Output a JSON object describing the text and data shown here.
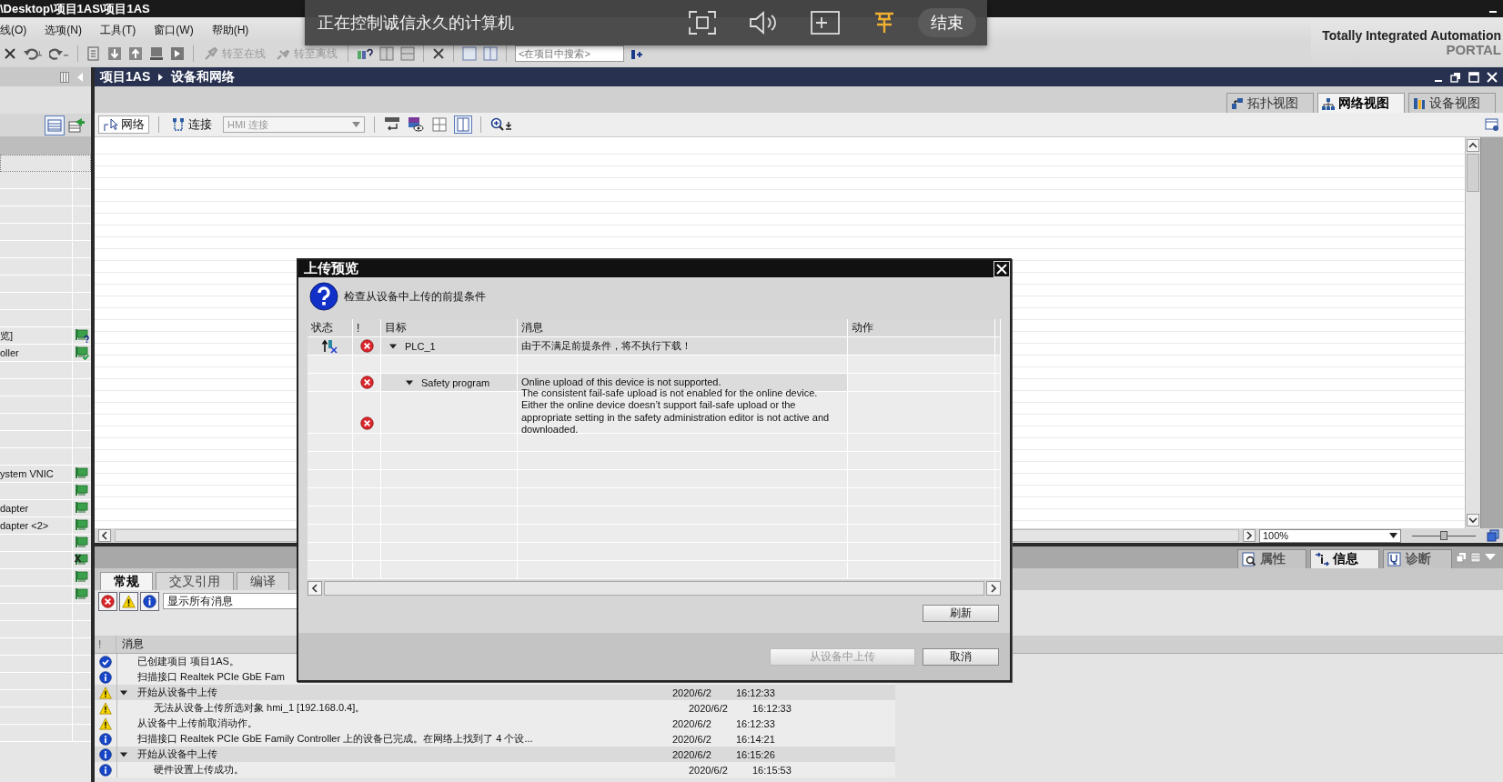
{
  "title_bar": {
    "path": "\\Desktop\\项目1AS\\项目1AS"
  },
  "remote_bar": {
    "message": "正在控制诚信永久的计算机",
    "end_button": "结束"
  },
  "menu": [
    {
      "label": "线(O)"
    },
    {
      "label": "选项(N)"
    },
    {
      "label": "工具(T)"
    },
    {
      "label": "窗口(W)"
    },
    {
      "label": "帮助(H)"
    }
  ],
  "brand": {
    "line1": "Totally Integrated Automation",
    "line2": "PORTAL"
  },
  "toolbar": {
    "go_online": "转至在线",
    "go_offline": "转至离线",
    "search_placeholder": "<在项目中搜索>"
  },
  "breadcrumb": [
    "项目1AS",
    "设备和网络"
  ],
  "view_tabs": [
    {
      "label": "拓扑视图",
      "selected": false
    },
    {
      "label": "网络视图",
      "selected": true
    },
    {
      "label": "设备视图",
      "selected": false
    }
  ],
  "editor_toolbar": {
    "network": "网络",
    "connection": "连接",
    "connection_type": "HMI 连接"
  },
  "zoom": {
    "value": "100%",
    "level": 0.5
  },
  "left_panel": {
    "groups": [
      [
        {
          "text": "览]",
          "kind": "question"
        },
        {
          "text": "oller",
          "kind": "check"
        }
      ],
      [
        {
          "text": "ystem VNIC",
          "kind": "plain"
        },
        {
          "kind": "plain"
        },
        {
          "text": "dapter",
          "kind": "plain"
        },
        {
          "text": "dapter <2>",
          "kind": "plain"
        },
        {
          "kind": "plain"
        },
        {
          "kind": "cross"
        },
        {
          "kind": "plain"
        },
        {
          "kind": "plain"
        }
      ]
    ]
  },
  "inspector_tabs": [
    {
      "label": "属性",
      "selected": false
    },
    {
      "label": "信息",
      "selected": true
    },
    {
      "label": "诊断",
      "selected": false
    }
  ],
  "info_tabs": [
    {
      "label": "常规",
      "selected": true
    },
    {
      "label": "交叉引用",
      "selected": false
    },
    {
      "label": "编译",
      "selected": false
    }
  ],
  "filters": [
    {
      "kind": "error",
      "on": true
    },
    {
      "kind": "warning",
      "on": true
    },
    {
      "kind": "info",
      "on": true
    }
  ],
  "filter_select": {
    "value": "显示所有消息"
  },
  "messages": {
    "columns": [
      "!",
      "消息"
    ],
    "rows": [
      {
        "kind": "success",
        "text": "已创建项目 项目1AS。"
      },
      {
        "kind": "info",
        "text": "扫描接口 Realtek PCIe GbE Fam"
      },
      {
        "kind": "warning",
        "text": "开始从设备中上传",
        "date": "2020/6/2",
        "time": "16:12:33",
        "expanded": true,
        "children": [
          {
            "kind": "warning",
            "text": "无法从设备上传所选对象 hmi_1 [192.168.0.4]。",
            "date": "2020/6/2",
            "time": "16:12:33"
          }
        ]
      },
      {
        "kind": "warning",
        "text": "从设备中上传前取消动作。",
        "date": "2020/6/2",
        "time": "16:12:33"
      },
      {
        "kind": "info",
        "text": "扫描接口 Realtek PCIe GbE Family Controller 上的设备已完成。在网络上找到了 4 个设...",
        "date": "2020/6/2",
        "time": "16:14:21"
      },
      {
        "kind": "info",
        "text": "开始从设备中上传",
        "date": "2020/6/2",
        "time": "16:15:26",
        "expanded": true,
        "children": [
          {
            "kind": "info",
            "text": "硬件设置上传成功。",
            "date": "2020/6/2",
            "time": "16:15:53"
          }
        ]
      }
    ]
  },
  "dialog": {
    "title": "上传预览",
    "prompt": "检查从设备中上传的前提条件",
    "columns": [
      "状态",
      "!",
      "目标",
      "消息",
      "动作"
    ],
    "rows": [
      {
        "blocked": true,
        "kind": "error",
        "target": "PLC_1",
        "message": "由于不满足前提条件，将不执行下载！",
        "expanded": true,
        "children": [
          {
            "blocked": false,
            "kind": "error",
            "target": "Safety program",
            "message": "Online upload of this device is not supported.",
            "expanded": true,
            "children": [
              {
                "blocked": false,
                "kind": "error",
                "message": "The consistent fail-safe upload is not enabled for the online device. Either the online device doesn’t support fail-safe upload or the appropriate setting in the safety administration editor is not active and downloaded."
              }
            ]
          }
        ]
      }
    ],
    "refresh_button": "刷新",
    "upload_button": {
      "label": "从设备中上传",
      "disabled": true
    },
    "cancel_button": "取消"
  }
}
